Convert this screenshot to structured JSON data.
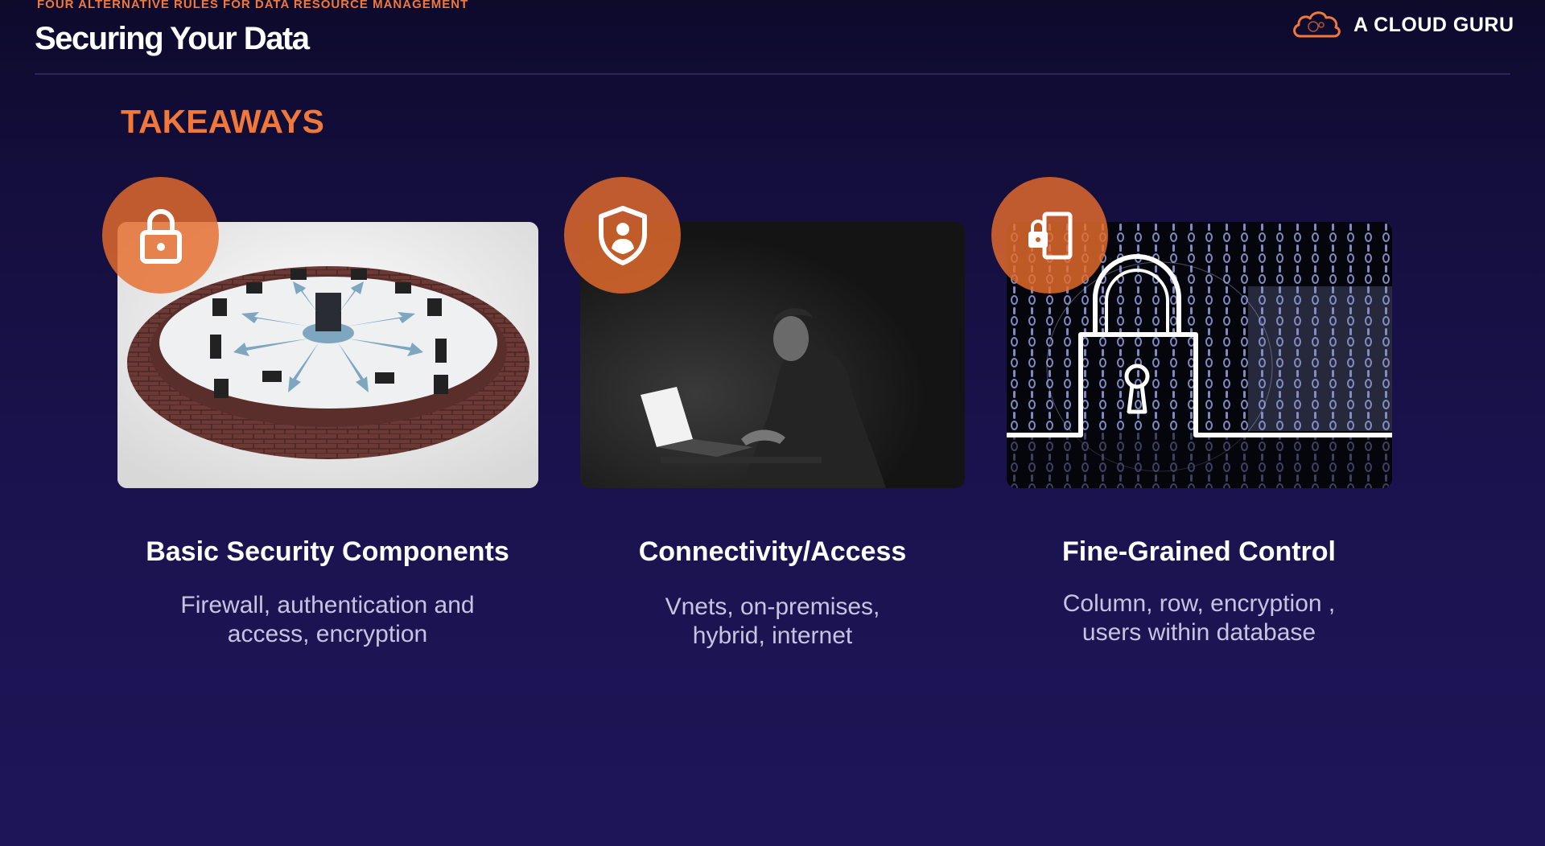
{
  "header": {
    "kicker": "FOUR ALTERNATIVE RULES FOR DATA RESOURCE MANAGEMENT",
    "title": "Securing Your Data"
  },
  "brand": {
    "name": "A CLOUD GURU",
    "icon": "cloud-logo-icon"
  },
  "section_heading": "TAKEAWAYS",
  "colors": {
    "accent": "#f0783a",
    "background": "#1b1350",
    "text": "#ffffff",
    "muted_text": "#c8c4e0"
  },
  "cards": [
    {
      "icon": "padlock-icon",
      "image": "brick-firewall-ring-network-illustration",
      "title": "Basic Security Components",
      "desc_lines": [
        "Firewall, authentication and",
        "access, encryption"
      ]
    },
    {
      "icon": "user-shield-icon",
      "image": "person-at-laptop-in-dark-photo",
      "title": "Connectivity/Access",
      "desc_lines": [
        "Vnets, on-premises,",
        "hybrid,  internet"
      ]
    },
    {
      "icon": "mobile-lock-icon",
      "image": "padlock-over-binary-code-graphic",
      "title": "Fine-Grained Control",
      "desc_lines": [
        "Column, row, encryption ,",
        "users within database"
      ]
    }
  ]
}
